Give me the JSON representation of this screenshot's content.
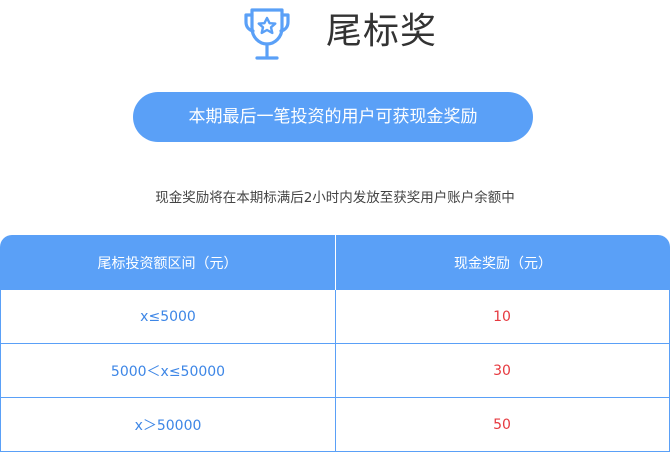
{
  "header": {
    "title": "尾标奖",
    "icon": "trophy-star-icon"
  },
  "banner": {
    "text": "本期最后一笔投资的用户可获现金奖励"
  },
  "note": {
    "text": "现金奖励将在本期标满后2小时内发放至获奖用户账户余额中"
  },
  "table": {
    "headers": [
      "尾标投资额区间（元）",
      "现金奖励（元）"
    ],
    "rows": [
      {
        "range": "x≤5000",
        "reward": "10"
      },
      {
        "range": "5000＜x≤50000",
        "reward": "30"
      },
      {
        "range": "x＞50000",
        "reward": "50"
      }
    ]
  },
  "colors": {
    "primary": "#5aa0f7",
    "range_text": "#3d86e6",
    "reward_text": "#e6393f",
    "title_text": "#333333"
  }
}
